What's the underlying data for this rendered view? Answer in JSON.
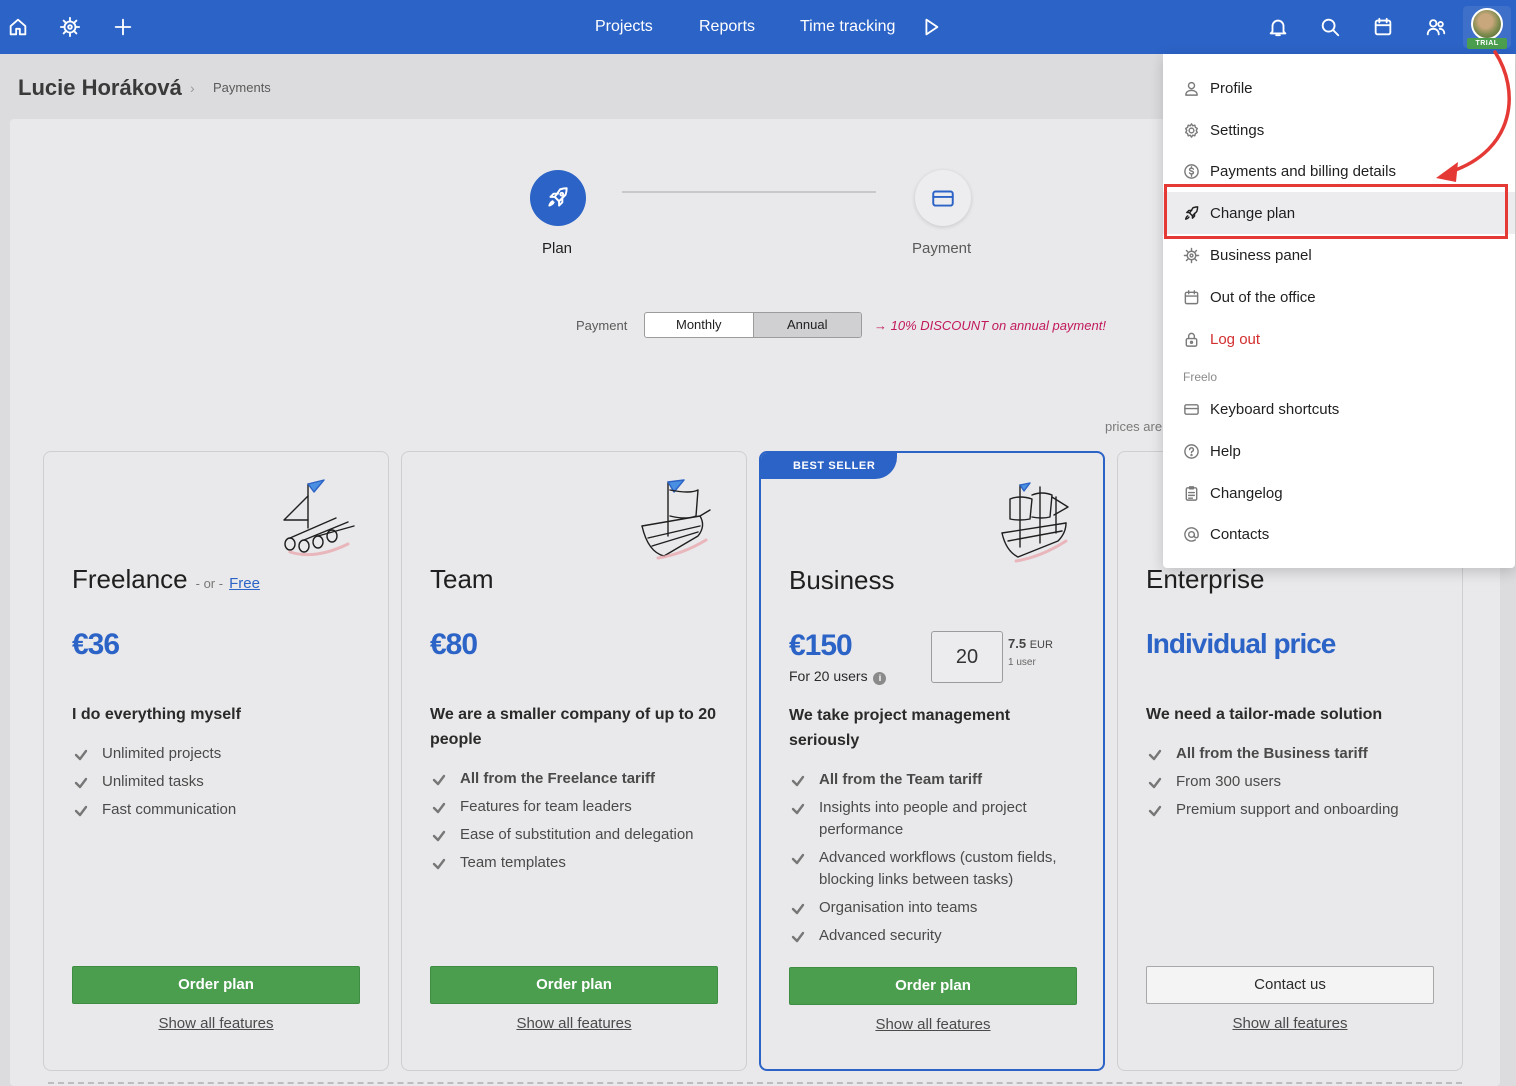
{
  "topbar": {
    "nav": [
      "Projects",
      "Reports",
      "Time tracking"
    ],
    "avatar_badge": "TRIAL",
    "icons": [
      "home-icon",
      "wheel-icon",
      "plus-icon",
      "play-icon",
      "bell-icon",
      "search-icon",
      "calendar-icon",
      "users-icon"
    ],
    "brand_color": "#2c63c6"
  },
  "header": {
    "user_name": "Lucie Horáková",
    "breadcrumb_sep": "›",
    "breadcrumb_current": "Payments"
  },
  "stepper": {
    "steps": [
      "Plan",
      "Payment"
    ]
  },
  "billing": {
    "label": "Payment",
    "options": [
      "Monthly",
      "Annual"
    ],
    "selected": "Annual",
    "discount": "→ 10% DISCOUNT on annual payment!",
    "prices_note": "prices are"
  },
  "plans": [
    {
      "name": "Freelance",
      "or_text": "- or -",
      "free_link": "Free",
      "price": "€36",
      "headline": "I do everything myself",
      "features": [
        {
          "text": "Unlimited projects",
          "strong": false
        },
        {
          "text": "Unlimited tasks",
          "strong": false
        },
        {
          "text": "Fast communication",
          "strong": false
        }
      ],
      "button": "Order plan",
      "show_all": "Show all features"
    },
    {
      "name": "Team",
      "price": "€80",
      "headline": "We are a smaller company of up to 20 people",
      "features": [
        {
          "text": "All from the Freelance tariff",
          "strong": true
        },
        {
          "text": "Features for team leaders",
          "strong": false
        },
        {
          "text": "Ease of substitution and delegation",
          "strong": false
        },
        {
          "text": "Team templates",
          "strong": false
        }
      ],
      "button": "Order plan",
      "show_all": "Show all features"
    },
    {
      "name": "Business",
      "ribbon": "BEST SELLER",
      "price": "€150",
      "for_users": "For 20 users",
      "qty": "20",
      "per_user_price": "7.5",
      "per_user_currency": "EUR",
      "per_user_unit": "1 user",
      "headline": "We take project management seriously",
      "features": [
        {
          "text": "All from the Team tariff",
          "strong": true
        },
        {
          "text": "Insights into people and project performance",
          "strong": false
        },
        {
          "text": "Advanced workflows (custom fields, blocking links between tasks)",
          "strong": false
        },
        {
          "text": "Organisation into teams",
          "strong": false
        },
        {
          "text": "Advanced security",
          "strong": false
        }
      ],
      "button": "Order plan",
      "show_all": "Show all features"
    },
    {
      "name": "Enterprise",
      "price": "Individual price",
      "headline": "We need a tailor-made solution",
      "features": [
        {
          "text": "All from the Business tariff",
          "strong": true
        },
        {
          "text": "From 300 users",
          "strong": false
        },
        {
          "text": "Premium support and onboarding",
          "strong": false
        }
      ],
      "button": "Contact us",
      "show_all": "Show all features"
    }
  ],
  "menu": {
    "items": [
      {
        "label": "Profile",
        "icon": "user-icon"
      },
      {
        "label": "Settings",
        "icon": "gear-icon"
      },
      {
        "label": "Payments and billing details",
        "icon": "dollar-icon"
      },
      {
        "label": "Change plan",
        "icon": "rocket-icon",
        "active": true
      },
      {
        "label": "Business panel",
        "icon": "wheel-icon"
      },
      {
        "label": "Out of the office",
        "icon": "calendar-icon"
      },
      {
        "label": "Log out",
        "icon": "lock-icon",
        "danger": true
      }
    ],
    "section": "Freelo",
    "section_items": [
      {
        "label": "Keyboard shortcuts",
        "icon": "keyboard-icon"
      },
      {
        "label": "Help",
        "icon": "help-icon"
      },
      {
        "label": "Changelog",
        "icon": "clipboard-icon"
      },
      {
        "label": "Contacts",
        "icon": "at-icon"
      }
    ]
  },
  "colors": {
    "primary": "#2c63c6",
    "order_button": "#4a9e4e",
    "discount": "#c2185b",
    "danger": "#d32f2f",
    "annotation": "#e53935"
  }
}
